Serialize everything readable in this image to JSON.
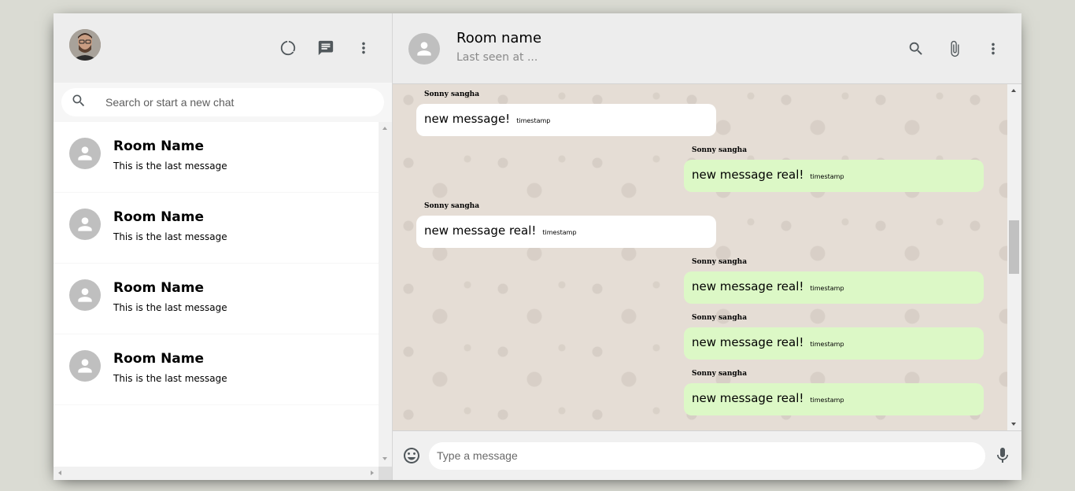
{
  "sidebar": {
    "search_placeholder": "Search or start a new chat",
    "icons": [
      "status-icon",
      "chat-icon",
      "more-vert-icon"
    ],
    "chats": [
      {
        "name": "Room Name",
        "last_message": "This is the last message"
      },
      {
        "name": "Room Name",
        "last_message": "This is the last message"
      },
      {
        "name": "Room Name",
        "last_message": "This is the last message"
      },
      {
        "name": "Room Name",
        "last_message": "This is the last message"
      }
    ]
  },
  "chat_header": {
    "room_name": "Room name",
    "last_seen": "Last seen at ...",
    "icons": [
      "search-icon",
      "attach-icon",
      "more-vert-icon"
    ]
  },
  "messages": [
    {
      "sender": "Sonny sangha",
      "text": "new message!",
      "timestamp": "timestamp",
      "own": false
    },
    {
      "sender": "Sonny sangha",
      "text": "new message real!",
      "timestamp": "timestamp",
      "own": true
    },
    {
      "sender": "Sonny sangha",
      "text": "new message real!",
      "timestamp": "timestamp",
      "own": false
    },
    {
      "sender": "Sonny sangha",
      "text": "new message real!",
      "timestamp": "timestamp",
      "own": true
    },
    {
      "sender": "Sonny sangha",
      "text": "new message real!",
      "timestamp": "timestamp",
      "own": true
    },
    {
      "sender": "Sonny sangha",
      "text": "new message real!",
      "timestamp": "timestamp",
      "own": true
    }
  ],
  "footer": {
    "input_placeholder": "Type a message"
  },
  "colors": {
    "own_bubble": "#dcf8c6",
    "other_bubble": "#ffffff",
    "chat_background": "#e5ddd5",
    "header_background": "#ededed"
  }
}
